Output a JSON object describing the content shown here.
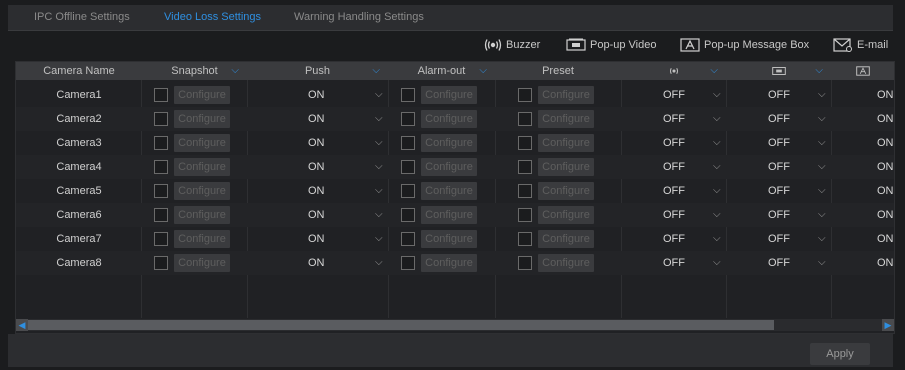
{
  "tabs": [
    {
      "label": "IPC Offline Settings",
      "active": false
    },
    {
      "label": "Video Loss Settings",
      "active": true
    },
    {
      "label": "Warning Handling Settings",
      "active": false
    }
  ],
  "legend": {
    "buzzer": "Buzzer",
    "popup_video": "Pop-up Video",
    "popup_message": "Pop-up Message Box",
    "email": "E-mail"
  },
  "columns": {
    "camera_name": "Camera Name",
    "snapshot": "Snapshot",
    "push": "Push",
    "alarm_out": "Alarm-out",
    "preset": "Preset"
  },
  "configure_label": "Configure",
  "rows": [
    {
      "camera": "Camera1",
      "push": "ON",
      "buzzer": "OFF",
      "popup_video": "OFF",
      "popup_message": "ON"
    },
    {
      "camera": "Camera2",
      "push": "ON",
      "buzzer": "OFF",
      "popup_video": "OFF",
      "popup_message": "ON"
    },
    {
      "camera": "Camera3",
      "push": "ON",
      "buzzer": "OFF",
      "popup_video": "OFF",
      "popup_message": "ON"
    },
    {
      "camera": "Camera4",
      "push": "ON",
      "buzzer": "OFF",
      "popup_video": "OFF",
      "popup_message": "ON"
    },
    {
      "camera": "Camera5",
      "push": "ON",
      "buzzer": "OFF",
      "popup_video": "OFF",
      "popup_message": "ON"
    },
    {
      "camera": "Camera6",
      "push": "ON",
      "buzzer": "OFF",
      "popup_video": "OFF",
      "popup_message": "ON"
    },
    {
      "camera": "Camera7",
      "push": "ON",
      "buzzer": "OFF",
      "popup_video": "OFF",
      "popup_message": "ON"
    },
    {
      "camera": "Camera8",
      "push": "ON",
      "buzzer": "OFF",
      "popup_video": "OFF",
      "popup_message": "ON"
    }
  ],
  "apply_label": "Apply",
  "colors": {
    "accent": "#2f8fe0",
    "background": "#1b1c1e",
    "header": "#3a3b3e"
  }
}
